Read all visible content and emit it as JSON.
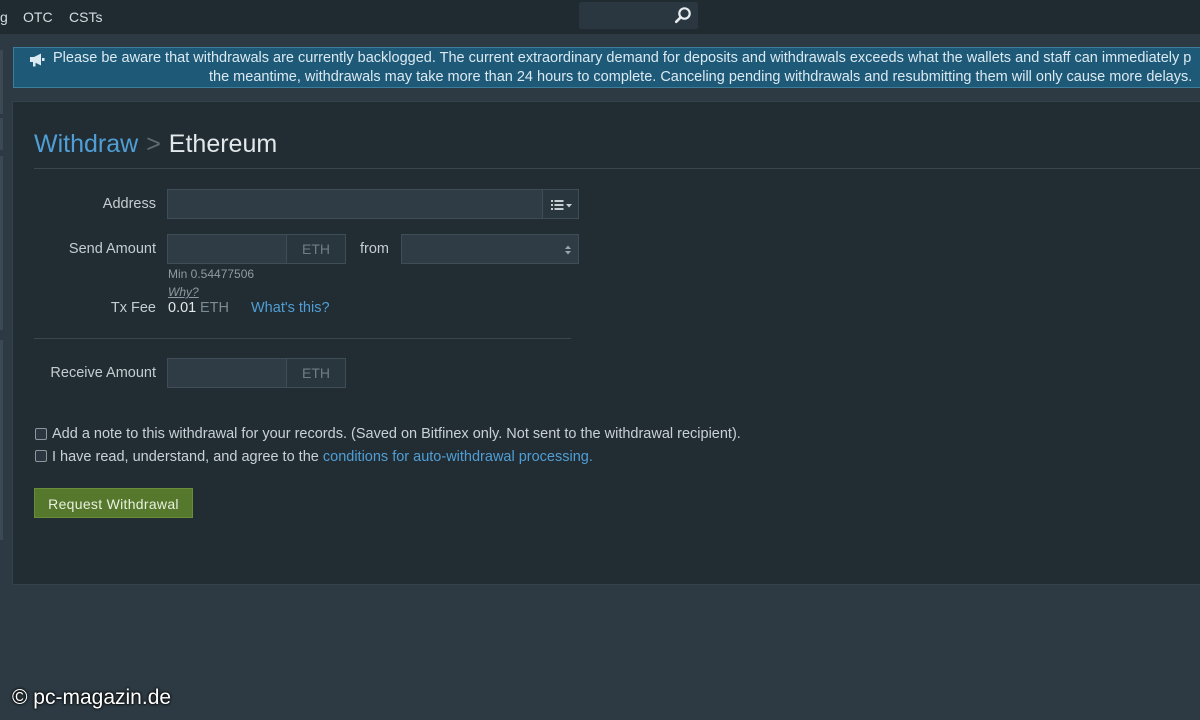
{
  "navbar": {
    "items": [
      "g",
      "OTC",
      "CSTs"
    ],
    "search_placeholder": ""
  },
  "alert": {
    "icon": "bullhorn-icon",
    "line1": "Please be aware that withdrawals are currently backlogged. The current extraordinary demand for deposits and withdrawals exceeds what the wallets and staff can immediately p",
    "line2": "the meantime, withdrawals may take more than 24 hours to complete. Canceling pending withdrawals and resubmitting them will only cause more delays."
  },
  "breadcrumb": {
    "parent": "Withdraw",
    "separator": ">",
    "current": "Ethereum"
  },
  "form": {
    "address_label": "Address",
    "address_value": "",
    "address_book_icon": "list-dropdown-icon",
    "send_amount_label": "Send Amount",
    "send_amount_value": "",
    "send_currency": "ETH",
    "from_label": "from",
    "from_value": "",
    "min_text": "Min 0.54477506",
    "why_text": "Why?",
    "tx_fee_label": "Tx Fee",
    "tx_fee_value": "0.01",
    "tx_fee_currency": "ETH",
    "whats_this": "What's this?",
    "receive_amount_label": "Receive Amount",
    "receive_amount_value": "",
    "receive_currency": "ETH",
    "note_checkbox_text": "Add a note to this withdrawal for your records. (Saved on Bitfinex only. Not sent to the withdrawal recipient).",
    "agree_text_prefix": "I have read, understand, and agree to the ",
    "agree_link_text": "conditions for auto-withdrawal processing",
    "agree_text_suffix": ".",
    "submit_label": "Request Withdrawal"
  },
  "watermark": "© pc-magazin.de",
  "colors": {
    "background": "#2d3a43",
    "panel": "#222c33",
    "accent_link": "#4f9fd6",
    "alert_bg": "#1e5a78",
    "button_green": "#55782c"
  }
}
